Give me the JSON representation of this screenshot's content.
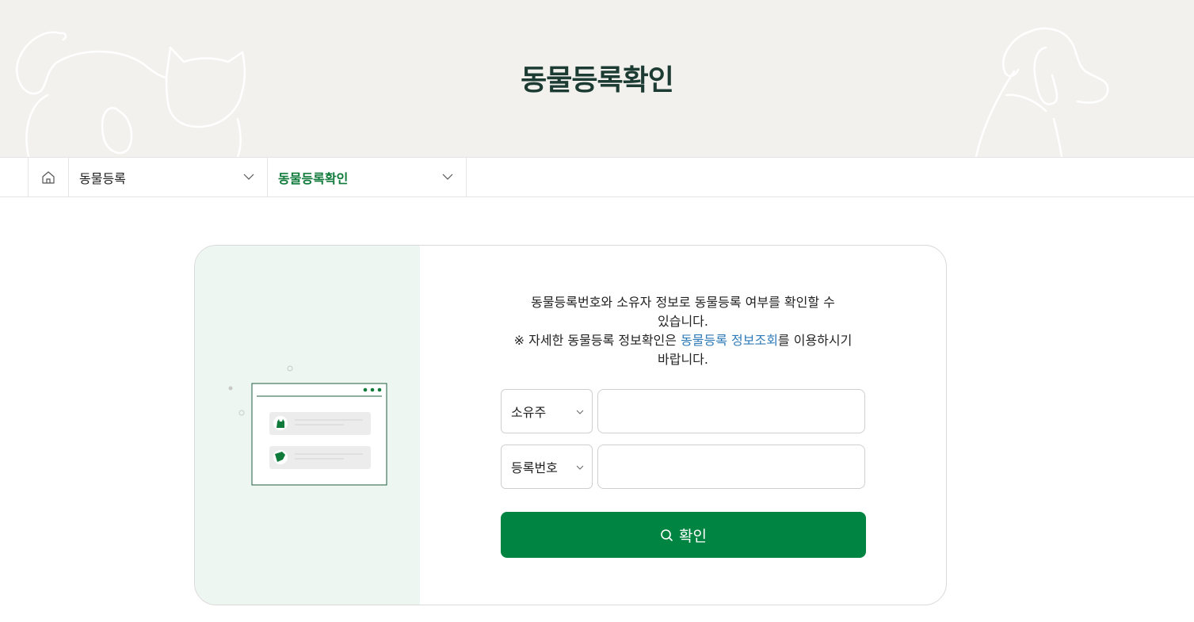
{
  "hero": {
    "title": "동물등록확인"
  },
  "breadcrumb": {
    "home_icon": "home-icon",
    "level1": "동물등록",
    "level2": "동물등록확인",
    "chevron_icon": "chevron-down-icon"
  },
  "form": {
    "desc_line1": "동물등록번호와 소유자 정보로 동물등록 여부를 확인할 수",
    "desc_line2": "있습니다.",
    "desc_line3_prefix": "※ 자세한 동물등록 정보확인은 ",
    "desc_link": "동물등록 정보조회",
    "desc_line3_suffix": "를 이용하시기",
    "desc_line4": "바랍니다.",
    "field1_select": "소유주",
    "field1_value": "",
    "field2_select": "등록번호",
    "field2_value": "",
    "submit_label": "확인",
    "submit_icon": "search-icon"
  },
  "colors": {
    "brand_green": "#008441",
    "active_green": "#0f7a3a",
    "link_blue": "#2d7ab8",
    "hero_bg": "#f2f1ed",
    "illustration_bg": "#edf6f1"
  }
}
